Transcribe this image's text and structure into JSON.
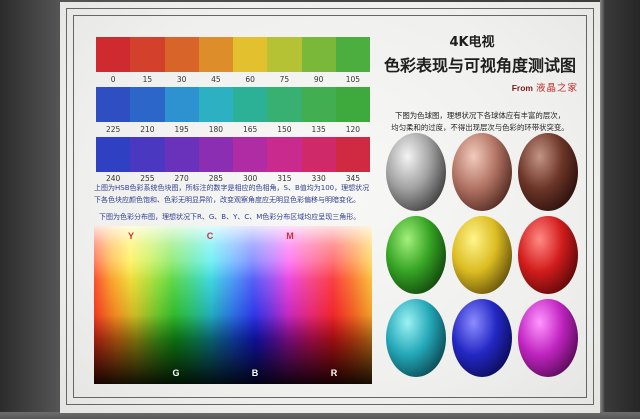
{
  "title": {
    "product": "4K电视",
    "subject": "色彩表现与可视角度测试图",
    "from_label": "From",
    "brand": "液晶之家"
  },
  "hsb_chart": {
    "rows": [
      {
        "swatches": [
          {
            "hue": 0,
            "color": "#cf2a30"
          },
          {
            "hue": 15,
            "color": "#d3402c"
          },
          {
            "hue": 30,
            "color": "#d8642a"
          },
          {
            "hue": 45,
            "color": "#dd8e2a"
          },
          {
            "hue": 60,
            "color": "#e2c02e"
          },
          {
            "hue": 75,
            "color": "#b4c234"
          },
          {
            "hue": 90,
            "color": "#7ab83a"
          },
          {
            "hue": 105,
            "color": "#4cae3e"
          }
        ]
      },
      {
        "swatches": [
          {
            "hue": 225,
            "color": "#2e4ec2"
          },
          {
            "hue": 210,
            "color": "#2c66c8"
          },
          {
            "hue": 195,
            "color": "#2e92d0"
          },
          {
            "hue": 180,
            "color": "#2cb0c2"
          },
          {
            "hue": 165,
            "color": "#2cb096"
          },
          {
            "hue": 150,
            "color": "#38b072"
          },
          {
            "hue": 135,
            "color": "#42ae52"
          },
          {
            "hue": 120,
            "color": "#3eaa3e"
          }
        ]
      },
      {
        "swatches": [
          {
            "hue": 240,
            "color": "#3040c2"
          },
          {
            "hue": 255,
            "color": "#4a38c0"
          },
          {
            "hue": 270,
            "color": "#6a32ba"
          },
          {
            "hue": 285,
            "color": "#8c2eb2"
          },
          {
            "hue": 300,
            "color": "#b02ca4"
          },
          {
            "hue": 315,
            "color": "#c82a8e"
          },
          {
            "hue": 330,
            "color": "#d0296a"
          },
          {
            "hue": 345,
            "color": "#d02a42"
          }
        ]
      }
    ],
    "caption": [
      "上图为HSB色彩系统色块图，所标注的数字是相应的色相角，S、B值均为100，理想状况",
      "下各色块应颜色饱和、色彩无明显异阶，改变观察角度应无明显色彩偏移与明暗变化。"
    ]
  },
  "distribution_chart": {
    "caption": "下图为色彩分布图，理想状况下R、G、B、Y、C、M色彩分布区域均应呈现三角形。",
    "top_labels": [
      "Y",
      "C",
      "M"
    ],
    "bottom_labels": [
      "G",
      "B",
      "R"
    ]
  },
  "sphere_chart": {
    "caption": [
      "下图为色球图，理想状况下各球体应有丰富的层次，",
      "均匀柔和的过度，不得出现层次与色彩的环带状突变。"
    ],
    "spheres": [
      {
        "highlight": "#f4f4f4",
        "base": "#a2a2a2",
        "shadow": "#262626"
      },
      {
        "highlight": "#f2cbbd",
        "base": "#b27464",
        "shadow": "#3a1610"
      },
      {
        "highlight": "#c49484",
        "base": "#6c3628",
        "shadow": "#1c0604"
      },
      {
        "highlight": "#a4f07c",
        "base": "#36a424",
        "shadow": "#082e06"
      },
      {
        "highlight": "#fff58a",
        "base": "#dcbc22",
        "shadow": "#463604"
      },
      {
        "highlight": "#ff8a84",
        "base": "#d21c1c",
        "shadow": "#3e0404"
      },
      {
        "highlight": "#9cf2f4",
        "base": "#24a8b8",
        "shadow": "#04303a"
      },
      {
        "highlight": "#8c8cff",
        "base": "#2428c4",
        "shadow": "#04043c"
      },
      {
        "highlight": "#ff96ff",
        "base": "#c024c0",
        "shadow": "#3c043c"
      }
    ]
  },
  "palette": {
    "text_blue": "#2f3f92",
    "text_dark": "#222222",
    "label_red": "#c8323a",
    "brand_red": "#b8302a",
    "from_red": "#7a1c1a",
    "frame": "#666666"
  }
}
